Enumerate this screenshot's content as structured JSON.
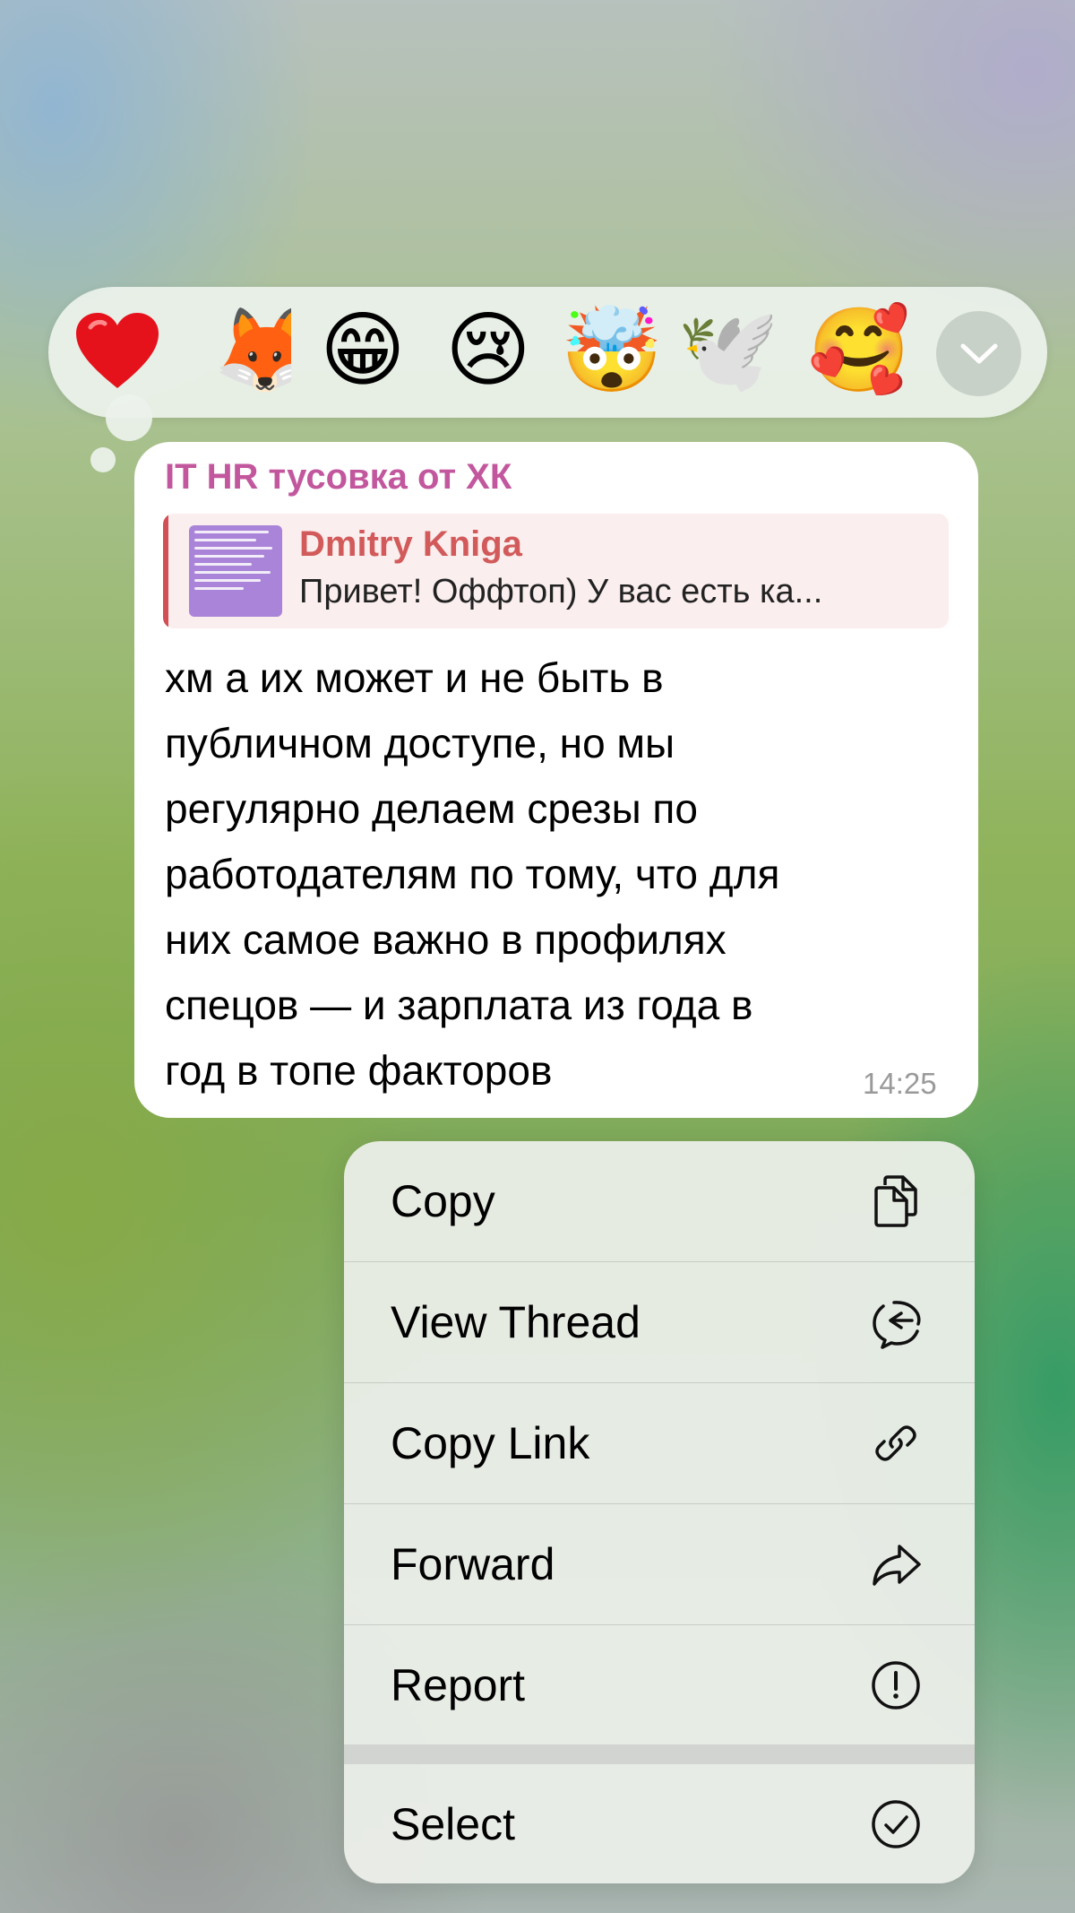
{
  "reactions": [
    {
      "name": "red-heart",
      "glyph": "❤️"
    },
    {
      "name": "fox-sticker",
      "glyph": "🦊"
    },
    {
      "name": "grinning-face",
      "glyph": "😁"
    },
    {
      "name": "crying-face",
      "glyph": "😢"
    },
    {
      "name": "exploding-head",
      "glyph": "🤯"
    },
    {
      "name": "dove-with-branch",
      "glyph": "🕊️"
    },
    {
      "name": "smiling-face-with-hearts",
      "glyph": "🥰"
    }
  ],
  "message": {
    "sender": "IT HR тусовка от ХК",
    "reply": {
      "author": "Dmitry Kniga",
      "text": "Привет! Оффтоп) У вас есть ка..."
    },
    "lines": [
      "хм а их может и не быть в",
      "публичном доступе, но мы",
      "регулярно делаем срезы по",
      "работодателям по тому, что для",
      "них самое важно в профилях",
      "спецов — и зарплата из года в",
      "год в топе факторов"
    ],
    "time": "14:25"
  },
  "menu": {
    "copy": "Copy",
    "view_thread": "View Thread",
    "copy_link": "Copy Link",
    "forward": "Forward",
    "report": "Report",
    "select": "Select"
  },
  "colors": {
    "sender": "#c2579e",
    "reply_accent": "#d24f55",
    "reply_bg": "#fbeeee",
    "bubble": "#ffffff"
  }
}
